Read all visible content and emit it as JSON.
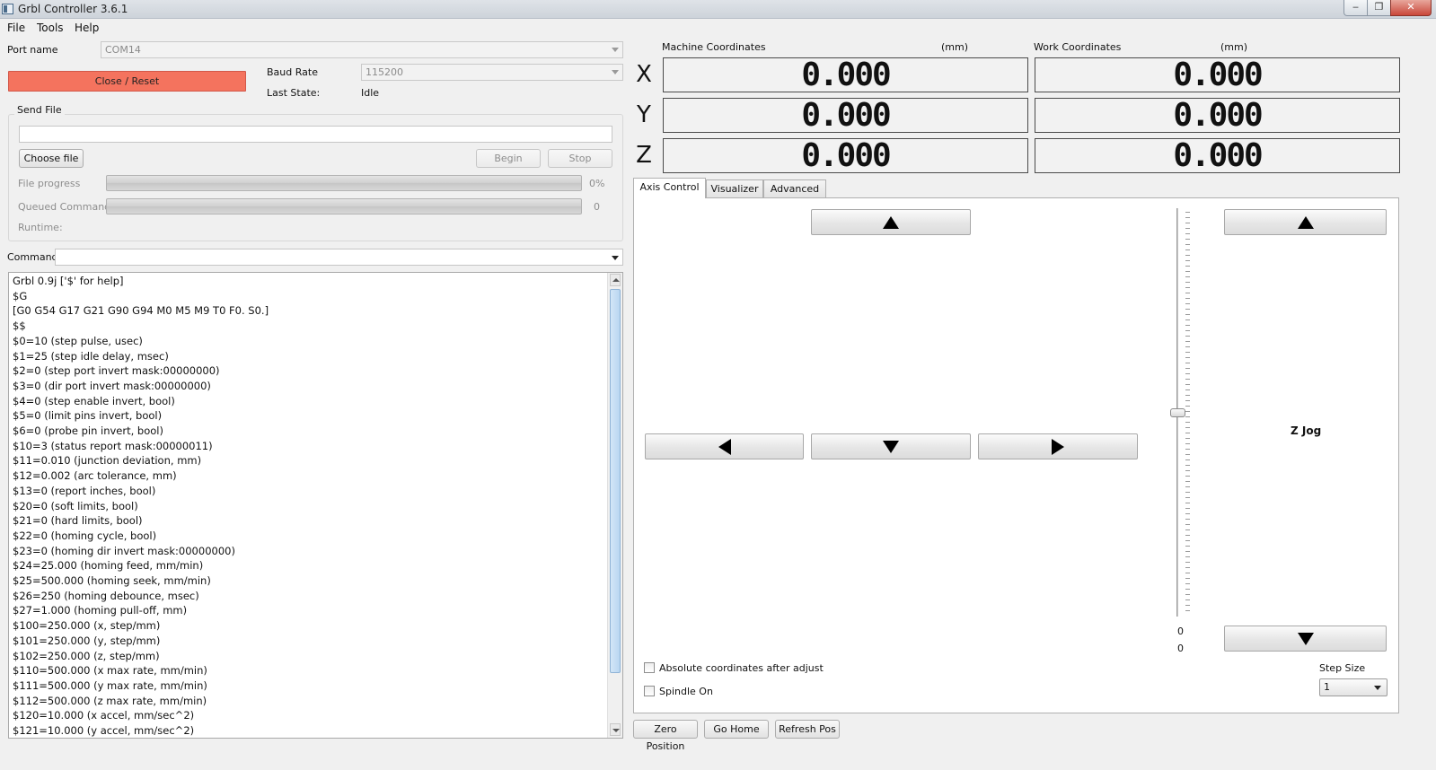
{
  "window": {
    "title": "Grbl Controller 3.6.1",
    "minimize_glyph": "‒",
    "maximize_glyph": "❐",
    "close_glyph": "✕"
  },
  "menu": [
    "File",
    "Tools",
    "Help"
  ],
  "connection": {
    "port_label": "Port name",
    "port_value": "COM14",
    "close_reset_label": "Close / Reset",
    "close_reset_color": "#f4735e",
    "baud_label": "Baud Rate",
    "baud_value": "115200",
    "last_state_label": "Last State:",
    "last_state_value": "Idle"
  },
  "send_file": {
    "group_label": "Send File",
    "file_path": "",
    "choose_label": "Choose file",
    "begin_label": "Begin",
    "stop_label": "Stop",
    "file_progress_label": "File progress",
    "file_progress_value": "0%",
    "file_progress_fraction": 0,
    "queued_label": "Queued Commands",
    "queued_value": "0",
    "runtime_label": "Runtime:"
  },
  "command": {
    "label": "Command",
    "value": ""
  },
  "console_lines": [
    "Grbl 0.9j ['$' for help]",
    "$G",
    "[G0 G54 G17 G21 G90 G94 M0 M5 M9 T0 F0. S0.]",
    "$$",
    "$0=10 (step pulse, usec)",
    "$1=25 (step idle delay, msec)",
    "$2=0 (step port invert mask:00000000)",
    "$3=0 (dir port invert mask:00000000)",
    "$4=0 (step enable invert, bool)",
    "$5=0 (limit pins invert, bool)",
    "$6=0 (probe pin invert, bool)",
    "$10=3 (status report mask:00000011)",
    "$11=0.010 (junction deviation, mm)",
    "$12=0.002 (arc tolerance, mm)",
    "$13=0 (report inches, bool)",
    "$20=0 (soft limits, bool)",
    "$21=0 (hard limits, bool)",
    "$22=0 (homing cycle, bool)",
    "$23=0 (homing dir invert mask:00000000)",
    "$24=25.000 (homing feed, mm/min)",
    "$25=500.000 (homing seek, mm/min)",
    "$26=250 (homing debounce, msec)",
    "$27=1.000 (homing pull-off, mm)",
    "$100=250.000 (x, step/mm)",
    "$101=250.000 (y, step/mm)",
    "$102=250.000 (z, step/mm)",
    "$110=500.000 (x max rate, mm/min)",
    "$111=500.000 (y max rate, mm/min)",
    "$112=500.000 (z max rate, mm/min)",
    "$120=10.000 (x accel, mm/sec^2)",
    "$121=10.000 (y accel, mm/sec^2)"
  ],
  "coordinates": {
    "machine_label": "Machine Coordinates",
    "work_label": "Work Coordinates",
    "unit": "(mm)",
    "axes": [
      {
        "letter": "X",
        "machine": "0.000",
        "work": "0.000"
      },
      {
        "letter": "Y",
        "machine": "0.000",
        "work": "0.000"
      },
      {
        "letter": "Z",
        "machine": "0.000",
        "work": "0.000"
      }
    ]
  },
  "tabs": [
    "Axis Control",
    "Visualizer",
    "Advanced"
  ],
  "axis_control": {
    "z_jog_label": "Z Jog",
    "slider_min": "0",
    "slider_value": "0",
    "absolute_coords_label": "Absolute coordinates after adjust",
    "absolute_coords_checked": false,
    "spindle_on_label": "Spindle On",
    "spindle_on_checked": false,
    "step_size_label": "Step Size",
    "step_size_value": "1"
  },
  "bottom_buttons": {
    "zero_position": "Zero Position",
    "go_home": "Go Home",
    "refresh_pos": "Refresh Pos"
  }
}
